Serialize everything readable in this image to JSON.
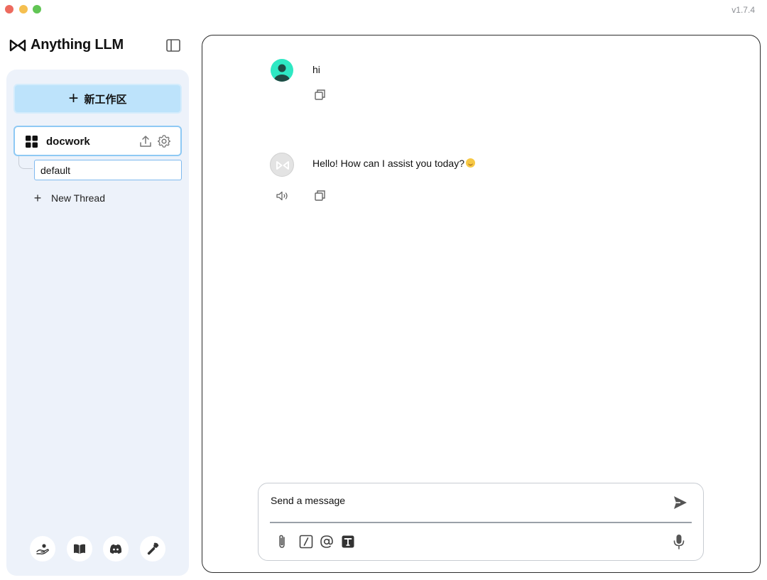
{
  "window": {
    "version": "v1.7.4"
  },
  "app": {
    "name": "Anything LLM"
  },
  "sidebar": {
    "new_workspace_label": "新工作区",
    "workspace": {
      "name": "docwork"
    },
    "thread": {
      "name": "default"
    },
    "new_thread_label": "New Thread",
    "footer_icons": [
      "support-icon",
      "docs-book-icon",
      "discord-icon",
      "settings-wrench-icon"
    ]
  },
  "chat": {
    "messages": [
      {
        "role": "user",
        "text": "hi"
      },
      {
        "role": "assistant",
        "text": "Hello! How can I assist you today?"
      }
    ]
  },
  "composer": {
    "placeholder": "Send a message",
    "tools": [
      "attach-icon",
      "slash-command-icon",
      "at-mention-icon",
      "text-size-icon"
    ]
  },
  "colors": {
    "accent": "#bde3fb",
    "selected_border": "#8ec9f4",
    "sidebar_bg": "#edf2fa",
    "user_avatar": "#2ee8c3"
  }
}
